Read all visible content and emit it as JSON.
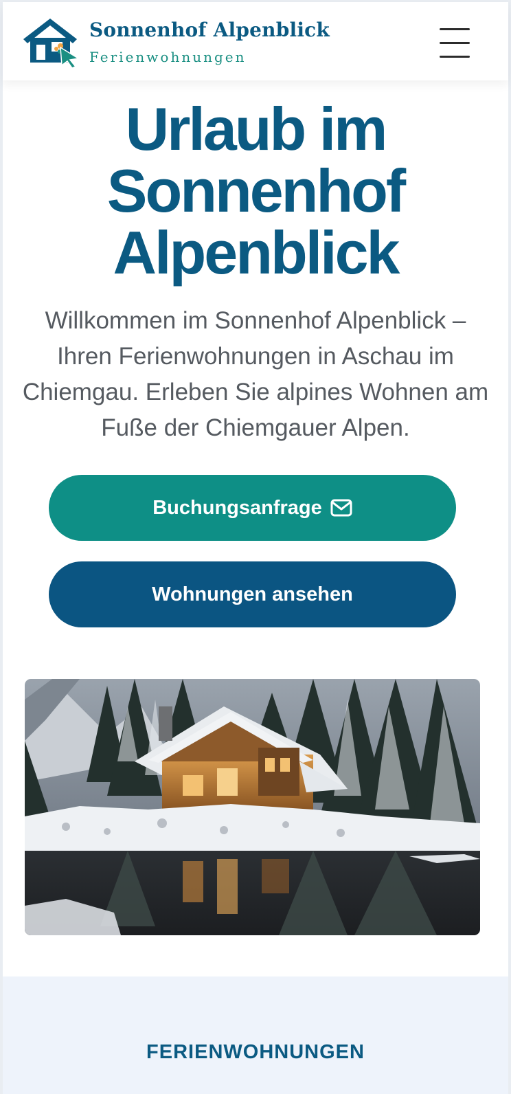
{
  "header": {
    "brand_name": "Sonnenhof Alpenblick",
    "brand_subtitle": "Ferienwohnungen",
    "logo_icon": "house-cursor-icon",
    "menu_icon": "hamburger-menu-icon"
  },
  "hero": {
    "title_lines": [
      "Urlaub im",
      "Sonnenhof",
      "Alpenblick"
    ],
    "text": "Willkommen im Sonnenhof Alpenblick – Ihren Ferienwohnungen in Aschau im Chiemgau. Erleben Sie alpines Wohnen am Fuße der Chiemgauer Alpen.",
    "booking_label": "Buchungsanfrage",
    "booking_icon": "mail-icon",
    "apartments_label": "Wohnungen ansehen",
    "image_subject": "snow-covered-cabin-by-lake"
  },
  "section": {
    "label": "FERIENWOHNUNGEN"
  },
  "colors": {
    "brand_blue": "#0b5a82",
    "teal": "#0e8f86",
    "dark_blue_button": "#0b5582",
    "body_text": "#555a60",
    "section_background": "#eef3fb"
  }
}
